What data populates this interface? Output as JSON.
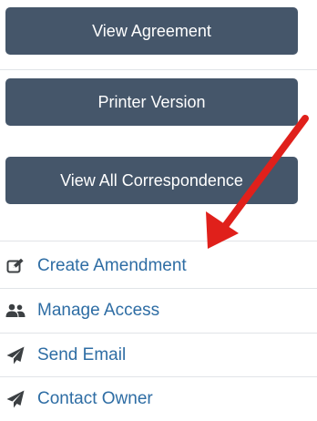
{
  "actions": {
    "view_agreement": "View Agreement",
    "printer_version": "Printer Version",
    "view_all_correspondence": "View All Correspondence"
  },
  "menu": {
    "items": [
      {
        "label": "Create Amendment",
        "icon": "edit-icon"
      },
      {
        "label": "Manage Access",
        "icon": "users-icon"
      },
      {
        "label": "Send Email",
        "icon": "paper-plane-icon"
      },
      {
        "label": "Contact Owner",
        "icon": "paper-plane-icon"
      }
    ]
  },
  "colors": {
    "button_bg": "#45566a",
    "button_text": "#ffffff",
    "link": "#2e6da4",
    "icon": "#3c4043",
    "annotation_arrow": "#e0201b",
    "divider": "#e1e4e8"
  }
}
